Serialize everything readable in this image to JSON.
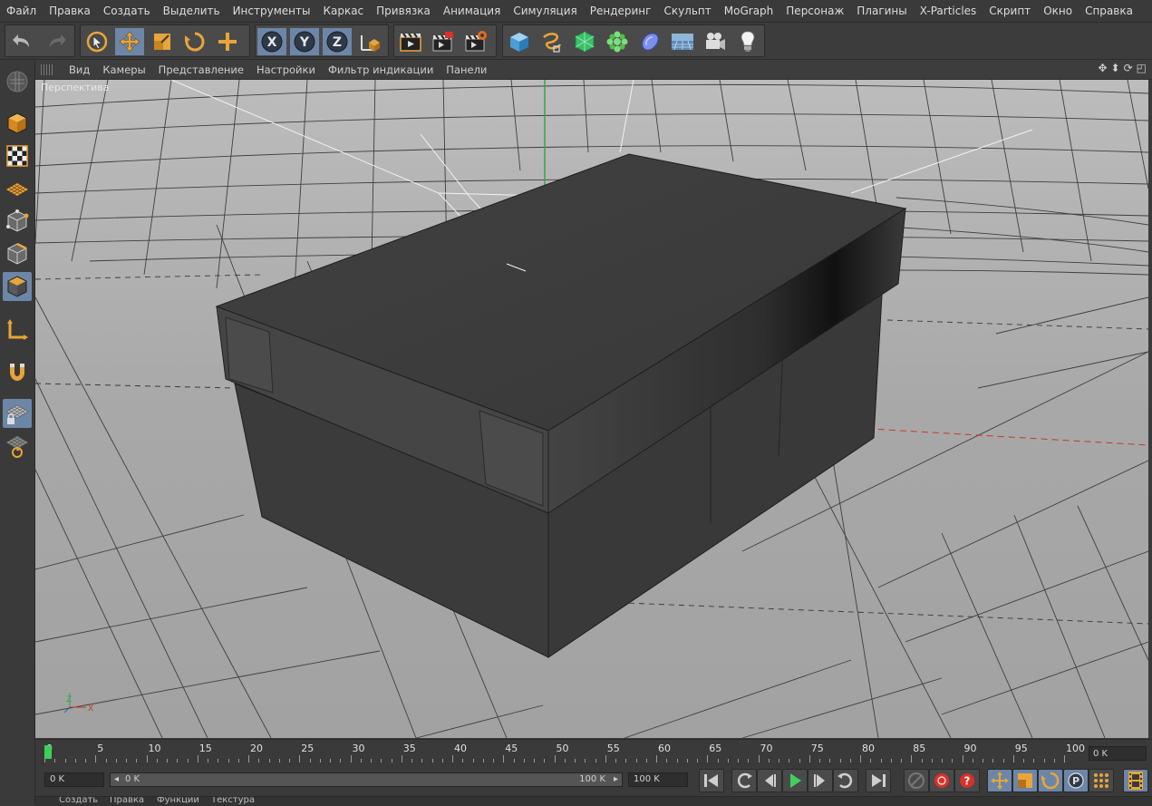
{
  "menu": [
    "Файл",
    "Правка",
    "Создать",
    "Выделить",
    "Инструменты",
    "Каркас",
    "Привязка",
    "Анимация",
    "Симуляция",
    "Рендеринг",
    "Скульпт",
    "MoGraph",
    "Персонаж",
    "Плагины",
    "X-Particles",
    "Скрипт",
    "Окно",
    "Справка"
  ],
  "toolbar_icons": [
    "undo-icon",
    "redo-icon",
    "live-selection-icon",
    "move-icon",
    "scale-icon",
    "rotate-icon",
    "add-icon",
    "x-axis-icon",
    "y-axis-icon",
    "z-axis-icon",
    "world-coordinate-icon",
    "render-view-icon",
    "render-picture-viewer-icon",
    "render-settings-icon",
    "cube-icon",
    "spline-pen-icon",
    "subdivision-icon",
    "mograph-cloner-icon",
    "deformer-icon",
    "floor-icon",
    "camera-icon",
    "light-icon"
  ],
  "axis_letters": {
    "x": "X",
    "y": "Y",
    "z": "Z"
  },
  "viewport": {
    "menu": [
      "Вид",
      "Камеры",
      "Представление",
      "Настройки",
      "Фильтр индикации",
      "Панели"
    ],
    "label": "Перспектива",
    "axis_x": "X",
    "axis_z": "Z"
  },
  "sidebar_icons": [
    "make-editable-icon",
    "model-mode-icon",
    "texture-mode-icon",
    "workplane-icon",
    "points-mode-icon",
    "edges-mode-icon",
    "polygons-mode-icon",
    "axis-mode-icon",
    "magnet-icon",
    "lock-workplane-icon",
    "snap-workplane-icon"
  ],
  "timeline": {
    "ticks": [
      "0",
      "5",
      "10",
      "15",
      "20",
      "25",
      "30",
      "35",
      "40",
      "45",
      "50",
      "55",
      "60",
      "65",
      "70",
      "75",
      "80",
      "85",
      "90",
      "95",
      "100"
    ],
    "current_frame": "0 K"
  },
  "transport": {
    "start_field": "0 K",
    "range_start": "0 K",
    "range_end": "100 K",
    "end_field": "100 K"
  },
  "bottom_menu": [
    "Создать",
    "Правка",
    "Функции",
    "Текстура"
  ],
  "colors": {
    "highlight": "#6c86a8",
    "orange": "#e8a53a",
    "viewport_bg": "#a6a6a6",
    "box": "#3c3c3c",
    "play": "#3fcf5a",
    "record": "#d9302a"
  }
}
